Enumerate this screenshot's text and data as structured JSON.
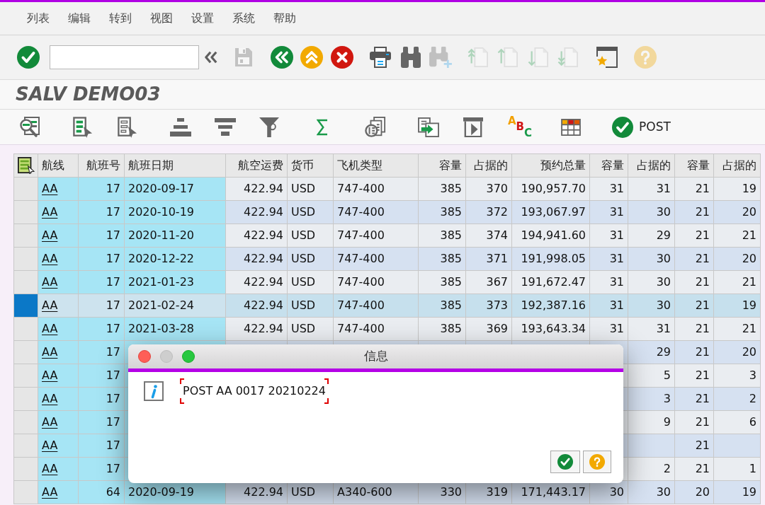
{
  "menu": [
    "列表",
    "编辑",
    "转到",
    "视图",
    "设置",
    "系统",
    "帮助"
  ],
  "toolbar": [
    {
      "kind": "enter",
      "disabled": false
    },
    {
      "kind": "command_field"
    },
    {
      "kind": "collapse",
      "disabled": false
    },
    {
      "kind": "save",
      "disabled": true
    },
    {
      "kind": "back",
      "disabled": false
    },
    {
      "kind": "exit",
      "disabled": false
    },
    {
      "kind": "cancel",
      "disabled": false
    },
    {
      "kind": "print",
      "disabled": false
    },
    {
      "kind": "find",
      "disabled": false
    },
    {
      "kind": "find_next",
      "disabled": true
    },
    {
      "kind": "first_page",
      "disabled": true
    },
    {
      "kind": "previous_page",
      "disabled": true
    },
    {
      "kind": "next_page",
      "disabled": true
    },
    {
      "kind": "last_page",
      "disabled": true
    },
    {
      "kind": "new_session",
      "disabled": false
    },
    {
      "kind": "help",
      "disabled": true
    }
  ],
  "title": "SALV DEMO03",
  "app_toolbar": [
    {
      "kind": "details"
    },
    {
      "kind": "select_all"
    },
    {
      "kind": "deselect_all"
    },
    {
      "kind": "sort_ascending"
    },
    {
      "kind": "sort_descending"
    },
    {
      "kind": "filter"
    },
    {
      "kind": "total"
    },
    {
      "kind": "print_preview"
    },
    {
      "kind": "export"
    },
    {
      "kind": "layout"
    },
    {
      "kind": "abc",
      "letters": [
        "A",
        "B",
        "C"
      ]
    },
    {
      "kind": "grid"
    },
    {
      "kind": "post",
      "label": "POST"
    }
  ],
  "table": {
    "columns": [
      {
        "label": "航线",
        "kind": "link",
        "key": true
      },
      {
        "label": "航班号",
        "kind": "number",
        "key": true
      },
      {
        "label": "航班日期",
        "kind": "text",
        "key": true
      },
      {
        "label": "航空运费",
        "kind": "number",
        "key": false
      },
      {
        "label": "货币",
        "kind": "text",
        "key": false
      },
      {
        "label": "飞机类型",
        "kind": "text",
        "key": false
      },
      {
        "label": "容量",
        "kind": "number",
        "key": false
      },
      {
        "label": "占据的",
        "kind": "number",
        "key": false
      },
      {
        "label": "预约总量",
        "kind": "number",
        "key": false
      },
      {
        "label": "容量",
        "kind": "number",
        "key": false
      },
      {
        "label": "占据的",
        "kind": "number",
        "key": false
      },
      {
        "label": "容量",
        "kind": "number",
        "key": false
      },
      {
        "label": "占据的",
        "kind": "number",
        "key": false
      }
    ],
    "rows": [
      {
        "selected": false,
        "cells": [
          "AA",
          "17",
          "2020-09-17",
          "422.94",
          "USD",
          "747-400",
          "385",
          "370",
          "190,957.70",
          "31",
          "31",
          "21",
          "19"
        ]
      },
      {
        "selected": false,
        "cells": [
          "AA",
          "17",
          "2020-10-19",
          "422.94",
          "USD",
          "747-400",
          "385",
          "372",
          "193,067.97",
          "31",
          "30",
          "21",
          "20"
        ]
      },
      {
        "selected": false,
        "cells": [
          "AA",
          "17",
          "2020-11-20",
          "422.94",
          "USD",
          "747-400",
          "385",
          "374",
          "194,941.60",
          "31",
          "29",
          "21",
          "21"
        ]
      },
      {
        "selected": false,
        "cells": [
          "AA",
          "17",
          "2020-12-22",
          "422.94",
          "USD",
          "747-400",
          "385",
          "371",
          "191,998.05",
          "31",
          "30",
          "21",
          "20"
        ]
      },
      {
        "selected": false,
        "cells": [
          "AA",
          "17",
          "2021-01-23",
          "422.94",
          "USD",
          "747-400",
          "385",
          "367",
          "191,672.47",
          "31",
          "30",
          "21",
          "21"
        ]
      },
      {
        "selected": true,
        "cells": [
          "AA",
          "17",
          "2021-02-24",
          "422.94",
          "USD",
          "747-400",
          "385",
          "373",
          "192,387.16",
          "31",
          "30",
          "21",
          "19"
        ]
      },
      {
        "selected": false,
        "cells": [
          "AA",
          "17",
          "2021-03-28",
          "422.94",
          "USD",
          "747-400",
          "385",
          "369",
          "193,643.34",
          "31",
          "31",
          "21",
          "21"
        ]
      },
      {
        "selected": false,
        "cells": [
          "AA",
          "17",
          null,
          null,
          null,
          null,
          null,
          null,
          null,
          null,
          "29",
          "21",
          "20"
        ]
      },
      {
        "selected": false,
        "cells": [
          "AA",
          "17",
          null,
          null,
          null,
          null,
          null,
          null,
          null,
          null,
          "5",
          "21",
          "3"
        ]
      },
      {
        "selected": false,
        "cells": [
          "AA",
          "17",
          null,
          null,
          null,
          null,
          null,
          null,
          null,
          null,
          "3",
          "21",
          "2"
        ]
      },
      {
        "selected": false,
        "cells": [
          "AA",
          "17",
          null,
          null,
          null,
          null,
          null,
          null,
          null,
          null,
          "9",
          "21",
          "6"
        ]
      },
      {
        "selected": false,
        "cells": [
          "AA",
          "17",
          null,
          null,
          null,
          null,
          null,
          null,
          null,
          null,
          null,
          "21",
          null
        ]
      },
      {
        "selected": false,
        "cells": [
          "AA",
          "17",
          null,
          null,
          null,
          null,
          null,
          null,
          null,
          null,
          "2",
          "21",
          "1"
        ]
      },
      {
        "selected": false,
        "cells": [
          "AA",
          "64",
          "2020-09-19",
          "422.94",
          "USD",
          "A340-600",
          "330",
          "319",
          "171,443.17",
          "30",
          "30",
          "20",
          "19"
        ]
      }
    ]
  },
  "dialog": {
    "title": "信息",
    "message": "POST AA 0017 20210224",
    "message_focused": true,
    "buttons": [
      {
        "kind": "ok"
      },
      {
        "kind": "help"
      }
    ]
  }
}
